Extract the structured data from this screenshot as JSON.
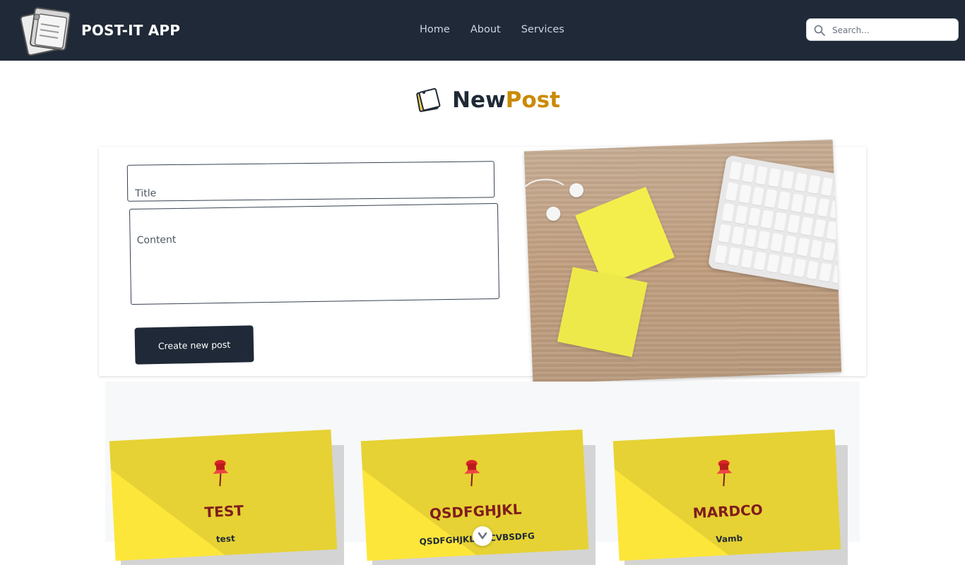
{
  "navbar": {
    "brand": "POST-IT APP",
    "links": [
      "Home",
      "About",
      "Services"
    ],
    "search_placeholder": "Search..."
  },
  "heading": {
    "part1": "New",
    "part2": "Post"
  },
  "form": {
    "title_placeholder": "Title",
    "content_placeholder": "Content",
    "submit_label": "Create new post"
  },
  "notes": [
    {
      "title": "TEST",
      "body": "test"
    },
    {
      "title": "QSDFGHJKL",
      "body": "QSDFGHJKLWXCVBSDFG"
    },
    {
      "title": "MARDCO",
      "body": "Vamb"
    }
  ],
  "colors": {
    "navbar": "#1f2937",
    "accent": "#ca8a04",
    "note": "#fde63a",
    "note_title": "#7f1d1d"
  }
}
